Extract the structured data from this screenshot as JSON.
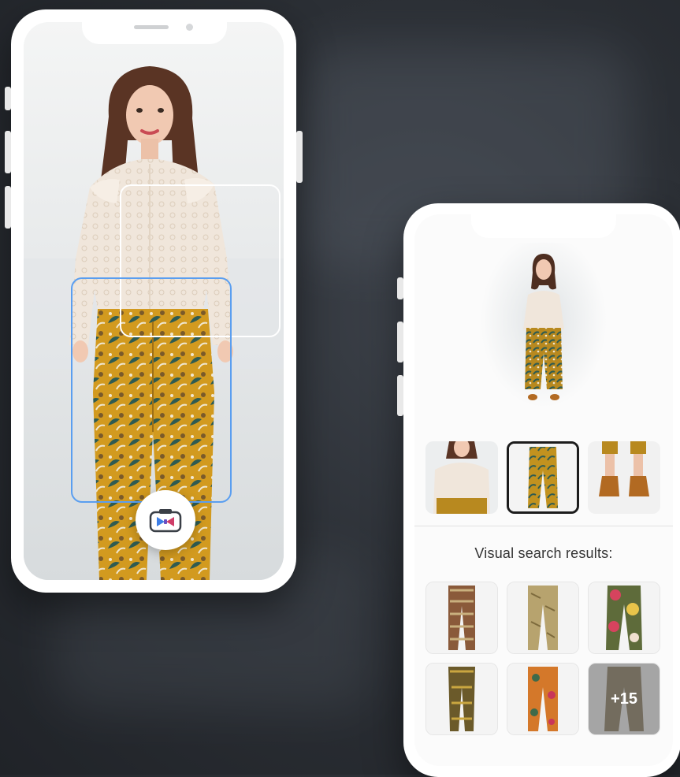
{
  "phone_camera": {
    "capture_icon": "camera-icon",
    "detection_boxes": [
      "top",
      "pants"
    ],
    "colors": {
      "pants_box": "#5a9ef0",
      "top_box": "#ffffff"
    }
  },
  "phone_results": {
    "crop_thumbnails": [
      "top",
      "pants",
      "shoes"
    ],
    "selected_thumbnail": "pants",
    "results_title": "Visual search results:",
    "more_count": "+15"
  }
}
